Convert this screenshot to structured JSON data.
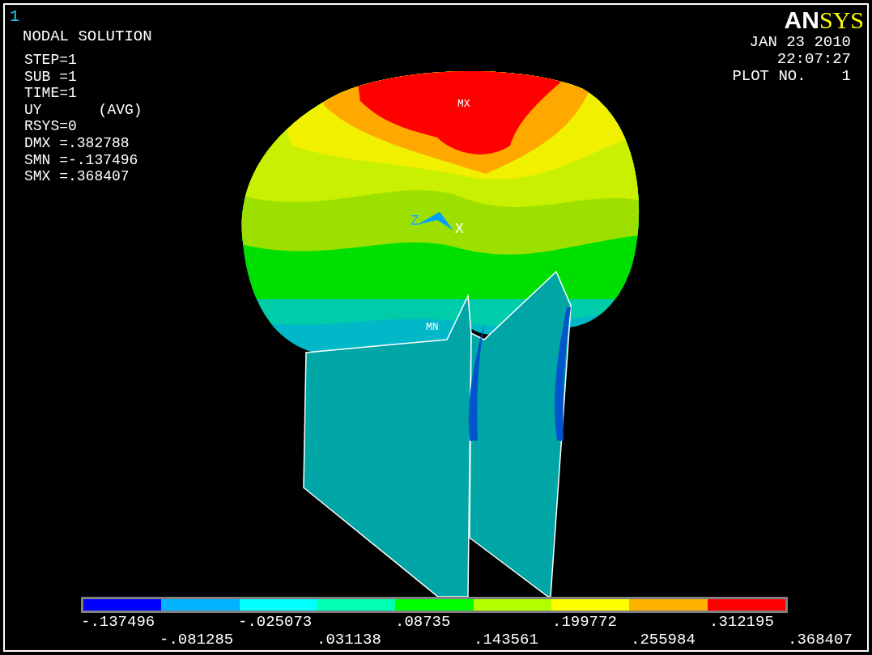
{
  "window_number": "1",
  "title": "NODAL SOLUTION",
  "steps": [
    "STEP=1",
    "SUB =1",
    "TIME=1"
  ],
  "result": {
    "component": "UY",
    "averaging": "(AVG)"
  },
  "stats": [
    "RSYS=0",
    "DMX =.382788",
    "SMN =-.137496",
    "SMX =.368407"
  ],
  "logo": {
    "part_1": "AN",
    "part_2": "SYS"
  },
  "date": "JAN 23 2010",
  "time": "22:07:27",
  "plot": {
    "label": "PLOT NO.",
    "number": "1"
  },
  "model_labels": {
    "max": "MX",
    "min": "MN",
    "axis_z": "Z",
    "axis_x": "X"
  },
  "legend": {
    "bands": [
      {
        "color": "#0000ff"
      },
      {
        "color": "#00b2ff"
      },
      {
        "color": "#00ffff"
      },
      {
        "color": "#00ffb2"
      },
      {
        "color": "#00ff00"
      },
      {
        "color": "#b2ff00"
      },
      {
        "color": "#ffff00"
      },
      {
        "color": "#ffb200"
      },
      {
        "color": "#ff0000"
      }
    ],
    "labels": [
      "-.137496",
      "-.081285",
      "-.025073",
      ".031138",
      ".08735",
      ".143561",
      ".199772",
      ".255984",
      ".312195",
      ".368407"
    ]
  }
}
